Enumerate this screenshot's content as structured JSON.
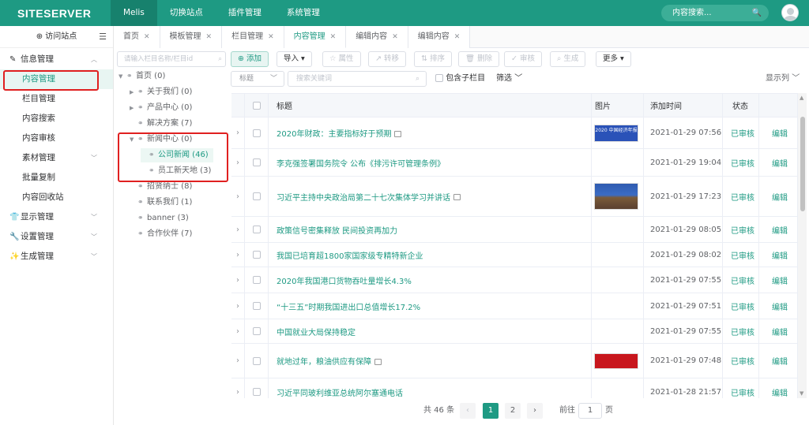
{
  "brand": {
    "logo": "SITESERVER",
    "accent": "#1e9a83",
    "highlight": "#e02020"
  },
  "topnav": {
    "items": [
      "Melis",
      "切换站点",
      "插件管理",
      "系统管理"
    ],
    "search_placeholder": "内容搜索...",
    "search_icon": "search-icon",
    "avatar_icon": "user-avatar-icon"
  },
  "sidebar": {
    "visit": "访问站点",
    "groups": [
      {
        "label": "信息管理",
        "icon": "edit-icon",
        "expanded": true,
        "items": [
          "内容管理",
          "栏目管理",
          "内容搜索",
          "内容审核",
          "素材管理",
          "批量复制",
          "内容回收站"
        ]
      },
      {
        "label": "显示管理",
        "icon": "shirt-icon"
      },
      {
        "label": "设置管理",
        "icon": "wrench-icon"
      },
      {
        "label": "生成管理",
        "icon": "magic-wand-icon"
      }
    ],
    "selected": "内容管理"
  },
  "tabs": [
    {
      "label": "首页"
    },
    {
      "label": "模板管理"
    },
    {
      "label": "栏目管理"
    },
    {
      "label": "内容管理",
      "active": true
    },
    {
      "label": "编辑内容"
    },
    {
      "label": "编辑内容"
    }
  ],
  "tree": {
    "search_placeholder": "请输入栏目名称/栏目id",
    "nodes": [
      {
        "label": "首页 (0)"
      },
      {
        "label": "关于我们 (0)"
      },
      {
        "label": "产品中心 (0)"
      },
      {
        "label": "解决方案 (7)"
      },
      {
        "label": "新闻中心 (0)"
      },
      {
        "label": "公司新闻 (46)"
      },
      {
        "label": "员工新天地 (3)"
      },
      {
        "label": "招贤纳士 (8)"
      },
      {
        "label": "联系我们 (1)"
      },
      {
        "label": "banner (3)"
      },
      {
        "label": "合作伙伴 (7)"
      }
    ]
  },
  "toolbar": {
    "add": "添加",
    "import": "导入",
    "attr": "属性",
    "move": "转移",
    "sort": "排序",
    "delete": "删除",
    "check": "审核",
    "create": "生成",
    "more": "更多"
  },
  "filter": {
    "field": "标题",
    "keyword_placeholder": "搜索关键词",
    "include_children": "包含子栏目",
    "filter": "筛选",
    "show_columns": "显示列"
  },
  "table": {
    "headers": {
      "title": "标题",
      "image": "图片",
      "time": "添加时间",
      "status": "状态"
    },
    "rows": [
      {
        "title": "2020年财政：主要指标好于预期",
        "has_img": true,
        "thumb": "2020 中国经济年报",
        "time": "2021-01-29 07:56",
        "status": "已审核",
        "action": "编辑"
      },
      {
        "title": "李克强签署国务院令 公布《排污许可管理条例》",
        "has_img": false,
        "time": "2021-01-29 19:04",
        "status": "已审核",
        "action": "编辑"
      },
      {
        "title": "习近平主持中央政治局第二十七次集体学习并讲话",
        "has_img": true,
        "thumb": "",
        "time": "2021-01-29 17:23",
        "status": "已审核",
        "action": "编辑"
      },
      {
        "title": "政策信号密集释放 民间投资再加力",
        "has_img": false,
        "time": "2021-01-29 08:05",
        "status": "已审核",
        "action": "编辑"
      },
      {
        "title": "我国已培育超1800家国家级专精特新企业",
        "has_img": false,
        "time": "2021-01-29 08:02",
        "status": "已审核",
        "action": "编辑"
      },
      {
        "title": "2020年我国港口货物吞吐量增长4.3%",
        "has_img": false,
        "time": "2021-01-29 07:55",
        "status": "已审核",
        "action": "编辑"
      },
      {
        "title": "“十三五”时期我国进出口总值增长17.2%",
        "has_img": false,
        "time": "2021-01-29 07:51",
        "status": "已审核",
        "action": "编辑"
      },
      {
        "title": "中国就业大局保持稳定",
        "has_img": false,
        "time": "2021-01-29 07:55",
        "status": "已审核",
        "action": "编辑"
      },
      {
        "title": "就地过年，粮油供应有保障",
        "has_img": true,
        "thumb": "",
        "time": "2021-01-29 07:48",
        "status": "已审核",
        "action": "编辑"
      },
      {
        "title": "习近平同玻利维亚总统阿尔塞通电话",
        "has_img": false,
        "time": "2021-01-28 21:57",
        "status": "已审核",
        "action": "编辑"
      }
    ]
  },
  "pager": {
    "total": "共 46 条",
    "pages": [
      "1",
      "2"
    ],
    "current": "1",
    "goto": "前往",
    "goto_value": "1",
    "page_unit": "页"
  }
}
